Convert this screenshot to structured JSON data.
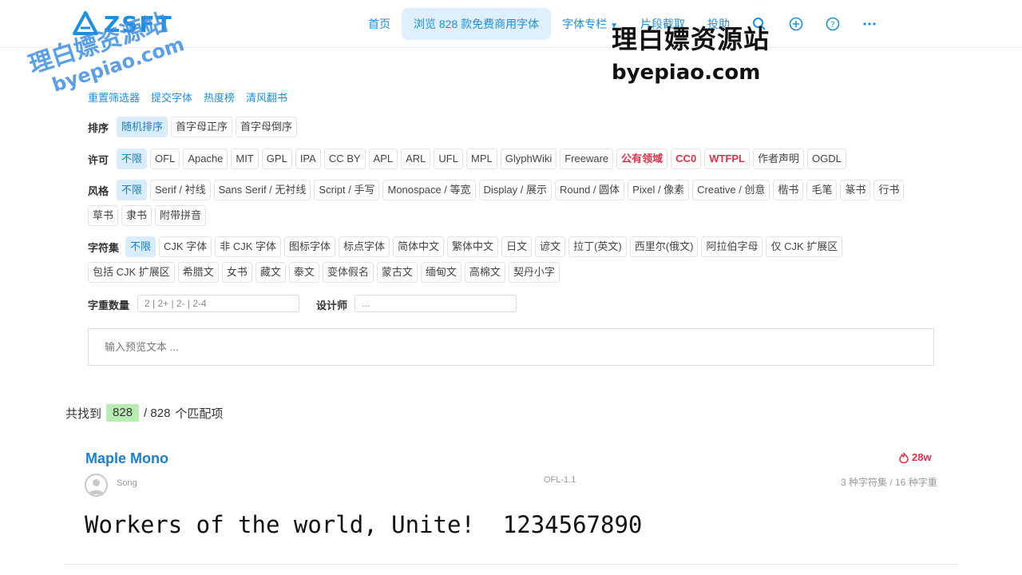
{
  "brand": {
    "logo_text": "ZSFT",
    "accent": "#1b8fe0"
  },
  "nav": {
    "items": [
      {
        "label": "首页",
        "active": false
      },
      {
        "label": "浏览 828 款免费商用字体",
        "active": true
      },
      {
        "label": "字体专栏",
        "active": false,
        "dropdown": true
      },
      {
        "label": "片段截取",
        "active": false
      },
      {
        "label": "投助",
        "active": false
      }
    ],
    "icons": [
      "search-icon",
      "plus-circle-icon",
      "help-circle-icon",
      "more-icon"
    ]
  },
  "watermark": {
    "text": "理白嫖资源站",
    "url": "byepiao.com"
  },
  "quicklinks": [
    "重置筛选器",
    "提交字体",
    "热度榜",
    "清风翻书"
  ],
  "filters": {
    "sort": {
      "label": "排序",
      "options": [
        "随机排序",
        "首字母正序",
        "首字母倒序"
      ],
      "selected": 0
    },
    "license": {
      "label": "许可",
      "options": [
        "不限",
        "OFL",
        "Apache",
        "MIT",
        "GPL",
        "IPA",
        "CC BY",
        "APL",
        "ARL",
        "UFL",
        "MPL",
        "GlyphWiki",
        "Freeware",
        "公有领域",
        "CC0",
        "WTFPL",
        "作者声明",
        "OGDL"
      ],
      "highlighted": [
        13,
        14,
        15
      ],
      "selected": 0
    },
    "style": {
      "label": "风格",
      "options": [
        "不限",
        "Serif / 衬线",
        "Sans Serif / 无衬线",
        "Script / 手写",
        "Monospace / 等宽",
        "Display / 展示",
        "Round / 圆体",
        "Pixel / 像素",
        "Creative / 创意",
        "楷书",
        "毛笔",
        "篆书",
        "行书",
        "草书",
        "隶书",
        "附带拼音"
      ],
      "selected": 0
    },
    "charset": {
      "label": "字符集",
      "options": [
        "不限",
        "CJK 字体",
        "非 CJK 字体",
        "图标字体",
        "标点字体",
        "简体中文",
        "繁体中文",
        "日文",
        "谚文",
        "拉丁(英文)",
        "西里尔(俄文)",
        "阿拉伯字母",
        "仅 CJK 扩展区",
        "包括 CJK 扩展区",
        "希腊文",
        "女书",
        "藏文",
        "泰文",
        "变体假名",
        "蒙古文",
        "缅甸文",
        "高棉文",
        "契丹小字"
      ],
      "selected": 0
    },
    "weights": {
      "label": "字重数量",
      "placeholder": "2 | 2+ | 2- | 2-4"
    },
    "designer": {
      "label": "设计师",
      "placeholder": "..."
    }
  },
  "preview": {
    "placeholder": "输入预览文本 ..."
  },
  "results": {
    "prefix": "共找到",
    "found": "828",
    "total": "/ 828",
    "suffix": "个匹配项"
  },
  "font_card": {
    "name": "Maple Mono",
    "hot": "28w",
    "author": "Song",
    "license": "OFL-1.1",
    "meta": "3 种字符集 / 16 种字重",
    "sample": "Workers of the world, Unite!  1234567890"
  }
}
